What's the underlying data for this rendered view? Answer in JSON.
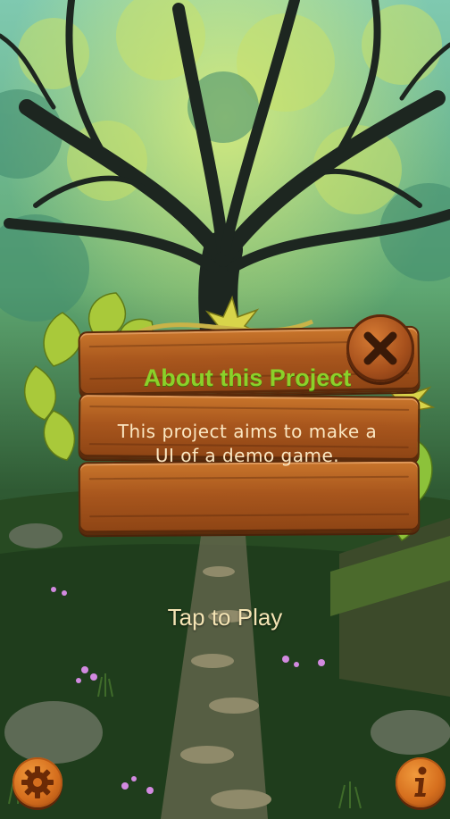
{
  "popup": {
    "title": "About this Project",
    "body": "This project aims to make a UI of a demo game.",
    "close_icon": "close-x-icon"
  },
  "main": {
    "tap_label": "Tap to Play"
  },
  "corner_buttons": {
    "settings_icon": "gear-icon",
    "info_icon": "info-icon"
  },
  "colors": {
    "title_green": "#8bd12a",
    "body_cream": "#fbe7c2",
    "wood": "#a8561d",
    "button_orange": "#d66f1e"
  }
}
